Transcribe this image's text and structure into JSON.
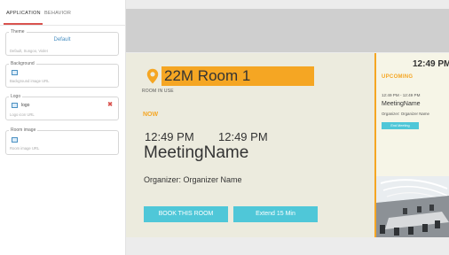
{
  "tabs": {
    "application": "APPLICATION",
    "behavior": "BEHAVIOR"
  },
  "theme": {
    "legend": "Theme",
    "value": "Default",
    "hint": "Default, Sungoo, Violet"
  },
  "background": {
    "legend": "Background",
    "hint": "Background image URL"
  },
  "logo": {
    "legend": "Logo",
    "value": "logo",
    "hint": "Logo icon URL",
    "remove": "✖"
  },
  "room_image": {
    "legend": "Room image",
    "hint": "Room image URL"
  },
  "preview": {
    "room_name": "22M Room 1",
    "room_status": "ROOM IN USE",
    "now_label": "NOW",
    "start_time": "12:49 PM",
    "end_time": "12:49 PM",
    "meeting_name": "MeetingName",
    "organizer": "Organizer: Organizer Name",
    "book_button": "BOOK THIS ROOM",
    "extend_button": "Extend 15 Min"
  },
  "side": {
    "clock": "12:49 PM",
    "upcoming_label": "UPCOMING",
    "meeting_time": "12:49 PM   - 12:49 PM",
    "meeting_name": "MeetingName",
    "organizer": "Organizer: Organizer Name",
    "end_button": "End Meeting"
  },
  "colors": {
    "accent": "#f5a623",
    "button": "#4fc7d8",
    "tab_underline": "#d9534f",
    "link": "#4a90c2"
  }
}
